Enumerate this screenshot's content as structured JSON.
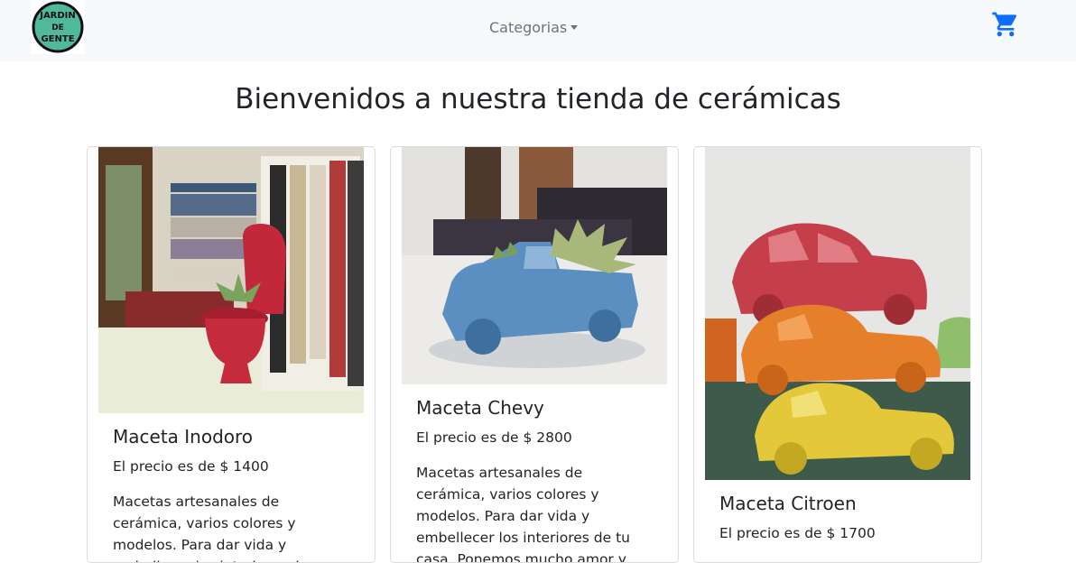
{
  "navbar": {
    "logo_text": "JARDIN DE GENTE",
    "categories_label": "Categorias",
    "cart_icon": "shopping-cart-icon"
  },
  "page": {
    "title": "Bienvenidos a nuestra tienda de cerámicas"
  },
  "colors": {
    "navbar_bg": "#f8f9fa",
    "cart_blue": "#0d6efd",
    "logo_green": "#4fb99a"
  },
  "products": [
    {
      "name": "Maceta Inodoro",
      "price": "El precio es de $ 1400",
      "description": "Macetas artesanales de cerámica, varios colores y modelos. Para dar vida y embellecer los interiores de"
    },
    {
      "name": "Maceta Chevy",
      "price": "El precio es de $ 2800",
      "description": "Macetas artesanales de cerámica, varios colores y modelos. Para dar vida y embellecer los interiores de tu casa. Ponemos mucho amor y"
    },
    {
      "name": "Maceta Citroen",
      "price": "El precio es de $ 1700",
      "description": ""
    }
  ]
}
